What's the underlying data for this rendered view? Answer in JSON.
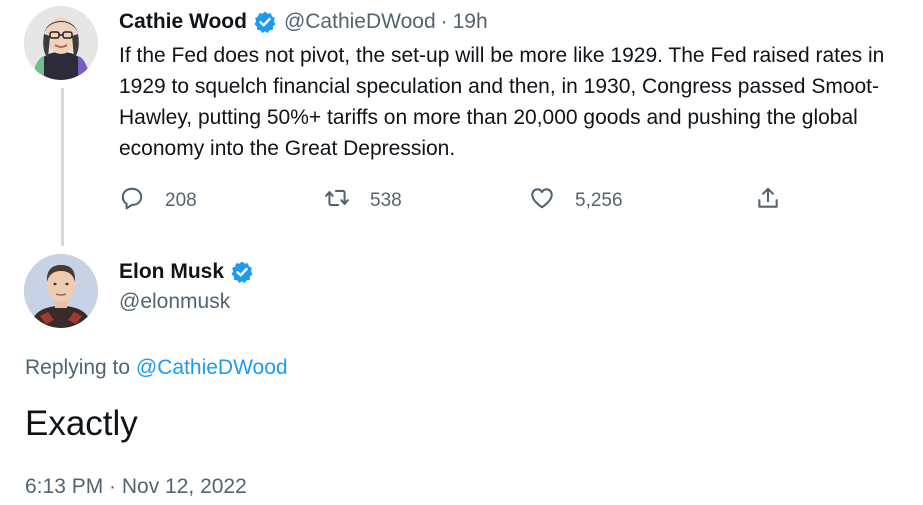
{
  "tweet": {
    "author_name": "Cathie Wood",
    "author_handle": "@CathieDWood",
    "separator": "·",
    "time": "19h",
    "text": "If the Fed does not pivot, the set-up will be more like 1929. The Fed raised rates in 1929 to squelch financial speculation and then, in 1930, Congress passed Smoot-Hawley, putting 50%+ tariffs on more than 20,000 goods and pushing the global economy into the Great Depression.",
    "actions": {
      "replies": "208",
      "retweets": "538",
      "likes": "5,256"
    },
    "icons": [
      "reply-icon",
      "retweet-icon",
      "like-icon",
      "share-icon",
      "verified-badge-icon"
    ]
  },
  "reply": {
    "author_name": "Elon Musk",
    "author_handle": "@elonmusk",
    "replying_prefix": "Replying to",
    "replying_to": "@CathieDWood",
    "text": "Exactly",
    "timestamp": "6:13 PM · Nov 12, 2022"
  },
  "colors": {
    "text_primary": "#0f1419",
    "text_secondary": "#536471",
    "accent": "#1d9bf0",
    "thread_line": "#cfd9de"
  }
}
